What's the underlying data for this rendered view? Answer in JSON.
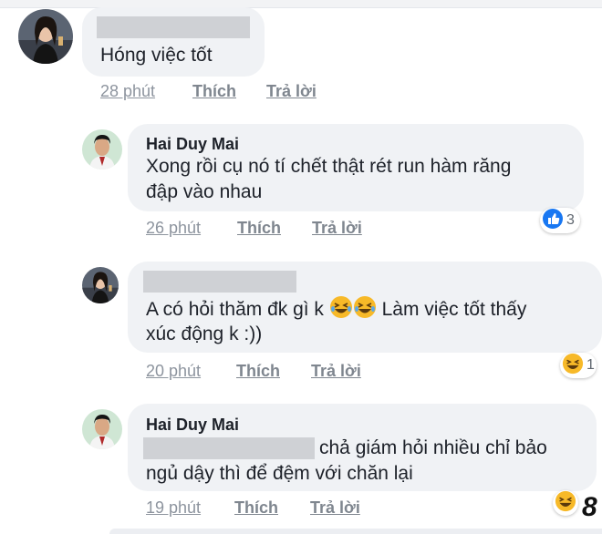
{
  "comments": [
    {
      "text": "Hóng việc tốt",
      "time": "28 phút",
      "like": "Thích",
      "reply": "Trả lời"
    },
    {
      "author": "Hai Duy Mai",
      "text_line1": "Xong rồi cụ nó tí chết thật rét run hàm răng",
      "text_line2": "đập vào nhau",
      "time": "26 phút",
      "like": "Thích",
      "reply": "Trả lời",
      "reaction_icon": "like-thumb-icon",
      "reaction_count": "3"
    },
    {
      "text_part1": "A có hỏi thăm đk gì k",
      "text_part2": "Làm việc tốt thấy",
      "text_line2": "xúc động k :))",
      "time": "20 phút",
      "like": "Thích",
      "reply": "Trả lời",
      "reaction_icon": "haha-icon",
      "reaction_count": "1"
    },
    {
      "author": "Hai Duy Mai",
      "text_line1": "chả giám hỏi nhiều chỉ bảo",
      "text_line2": "ngủ dậy thì để đệm với chăn lại",
      "time": "19 phút",
      "like": "Thích",
      "reply": "Trả lời",
      "reaction_icon": "haha-icon"
    }
  ],
  "watermark": "8",
  "colors": {
    "bubble": "#f0f2f5",
    "like_blue": "#1877f2",
    "haha_yellow": "#f7b928",
    "meta_gray": "#8d949e"
  }
}
